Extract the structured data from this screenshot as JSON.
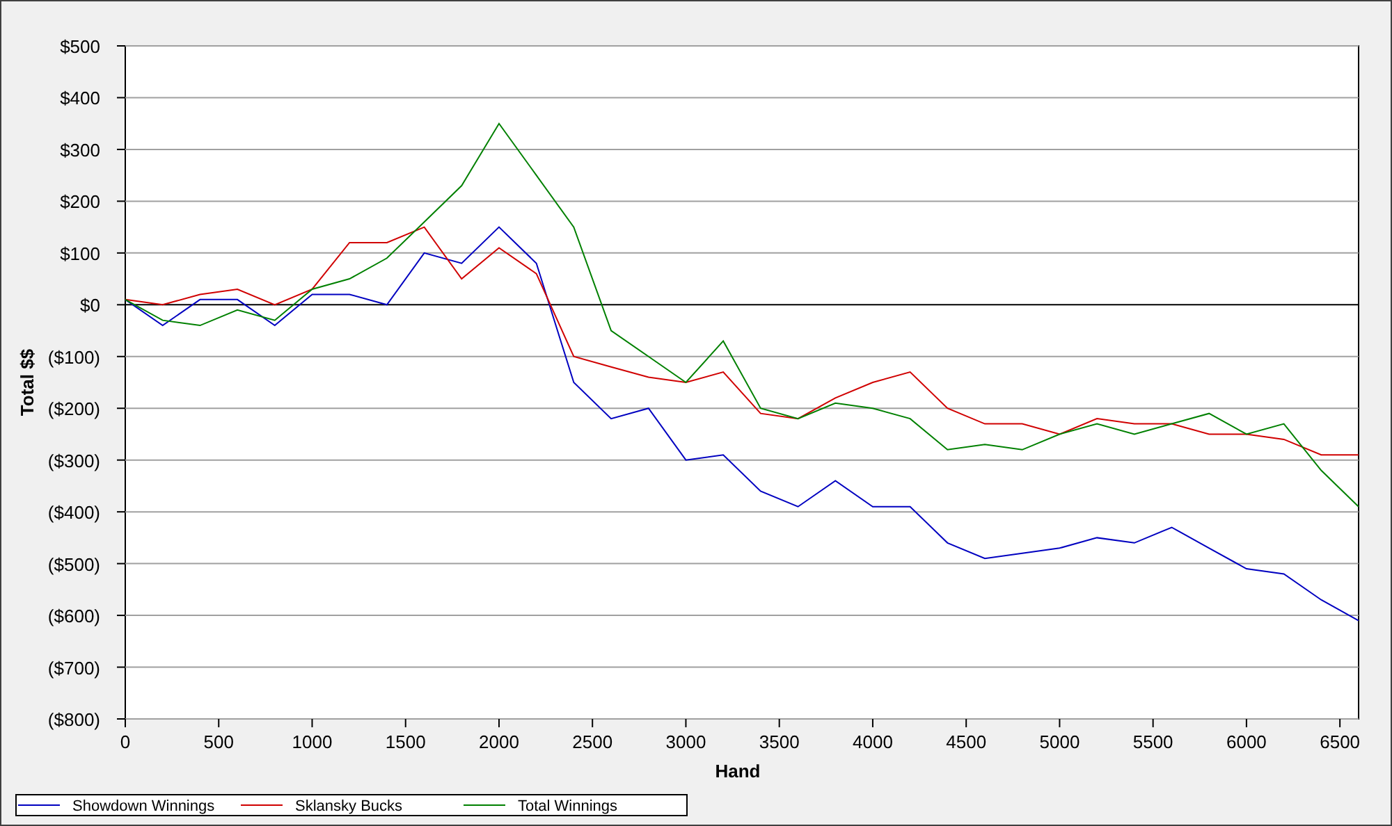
{
  "chart_data": {
    "type": "line",
    "xlabel": "Hand",
    "ylabel": "Total $$",
    "x": [
      0,
      200,
      400,
      600,
      800,
      1000,
      1200,
      1400,
      1600,
      1800,
      2000,
      2200,
      2400,
      2600,
      2800,
      3000,
      3200,
      3400,
      3600,
      3800,
      4000,
      4200,
      4400,
      4600,
      4800,
      5000,
      5200,
      5400,
      5600,
      5800,
      6000,
      6200,
      6400,
      6600
    ],
    "series": [
      {
        "name": "Showdown Winnings",
        "color": "#0000c0",
        "values": [
          10,
          -40,
          10,
          10,
          -40,
          20,
          20,
          0,
          100,
          80,
          150,
          80,
          -150,
          -220,
          -200,
          -300,
          -290,
          -360,
          -390,
          -340,
          -390,
          -390,
          -460,
          -490,
          -480,
          -470,
          -450,
          -460,
          -430,
          -470,
          -510,
          -520,
          -570,
          -610
        ]
      },
      {
        "name": "Sklansky Bucks",
        "color": "#d00000",
        "values": [
          10,
          0,
          20,
          30,
          0,
          30,
          120,
          120,
          150,
          50,
          110,
          60,
          -100,
          -120,
          -140,
          -150,
          -130,
          -210,
          -220,
          -180,
          -150,
          -130,
          -200,
          -230,
          -230,
          -250,
          -220,
          -230,
          -230,
          -250,
          -250,
          -260,
          -290,
          -290
        ]
      },
      {
        "name": "Total Winnings",
        "color": "#008000",
        "values": [
          10,
          -30,
          -40,
          -10,
          -30,
          30,
          50,
          90,
          160,
          230,
          350,
          250,
          150,
          -50,
          -100,
          -150,
          -70,
          -200,
          -220,
          -190,
          -200,
          -220,
          -280,
          -270,
          -280,
          -250,
          -230,
          -250,
          -230,
          -210,
          -250,
          -230,
          -320,
          -390
        ]
      }
    ],
    "grid": true,
    "legend": true,
    "xlim": [
      0,
      6600
    ],
    "ylim": [
      -800,
      500
    ],
    "xticks": [
      0,
      500,
      1000,
      1500,
      2000,
      2500,
      3000,
      3500,
      4000,
      4500,
      5000,
      5500,
      6000,
      6500
    ],
    "yticks": [
      {
        "value": 500,
        "label": "$500"
      },
      {
        "value": 400,
        "label": "$400"
      },
      {
        "value": 300,
        "label": "$300"
      },
      {
        "value": 200,
        "label": "$200"
      },
      {
        "value": 100,
        "label": "$100"
      },
      {
        "value": 0,
        "label": "$0"
      },
      {
        "value": -100,
        "label": "($100)"
      },
      {
        "value": -200,
        "label": "($200)"
      },
      {
        "value": -300,
        "label": "($300)"
      },
      {
        "value": -400,
        "label": "($400)"
      },
      {
        "value": -500,
        "label": "($500)"
      },
      {
        "value": -600,
        "label": "($600)"
      },
      {
        "value": -700,
        "label": "($700)"
      },
      {
        "value": -800,
        "label": "($800)"
      }
    ]
  }
}
